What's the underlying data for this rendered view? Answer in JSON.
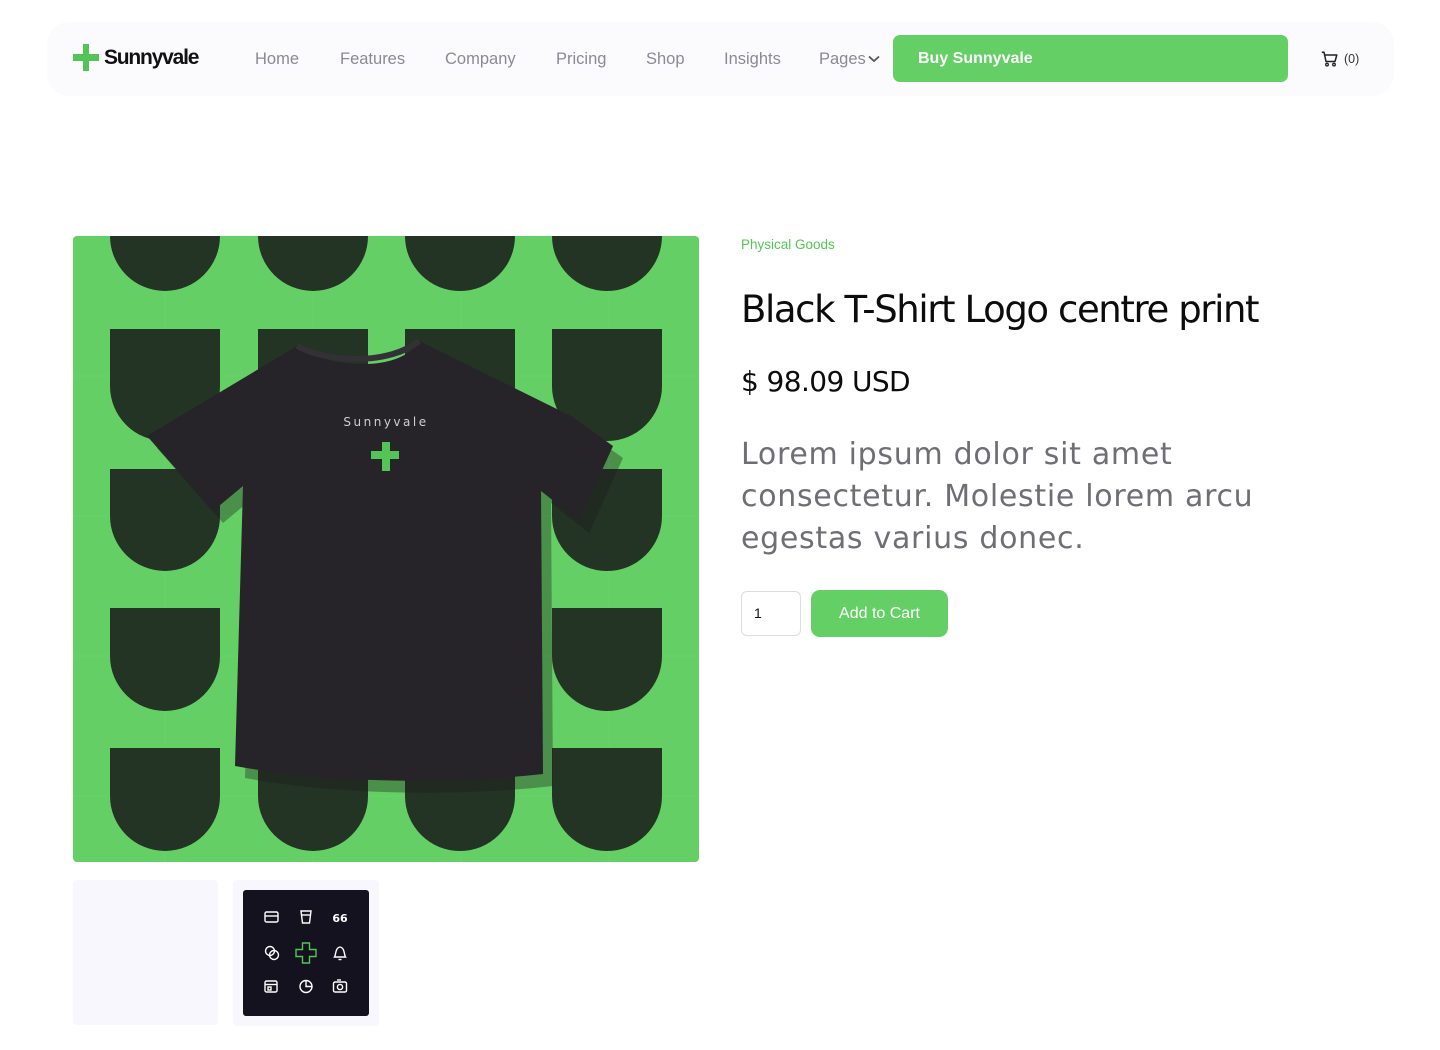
{
  "brand": {
    "name": "Sunnyvale",
    "accent": "#63cf64"
  },
  "nav": {
    "links": [
      "Home",
      "Features",
      "Company",
      "Pricing",
      "Shop",
      "Insights"
    ],
    "pages_label": "Pages",
    "buy_label": "Buy Sunnyvale",
    "cart_count": "(0)"
  },
  "product": {
    "category": "Physical Goods",
    "title": "Black T-Shirt Logo centre print",
    "price": "$ 98.09 USD",
    "description": "Lorem ipsum dolor sit amet consectetur. Molestie lorem arcu egestas varius donec.",
    "quantity": "1",
    "add_to_cart_label": "Add to Cart",
    "image": {
      "name": "tshirt-product-image",
      "shirt_print": "Sunnyvale"
    },
    "thumbnails": [
      "thumbnail-blank",
      "thumbnail-icon-grid"
    ],
    "thumbnail_icons": [
      "card-icon",
      "cup-icon",
      "quote-icon",
      "chat-icon",
      "plus-logo-icon",
      "bell-icon",
      "calendar-icon",
      "pie-chart-icon",
      "camera-icon"
    ]
  }
}
